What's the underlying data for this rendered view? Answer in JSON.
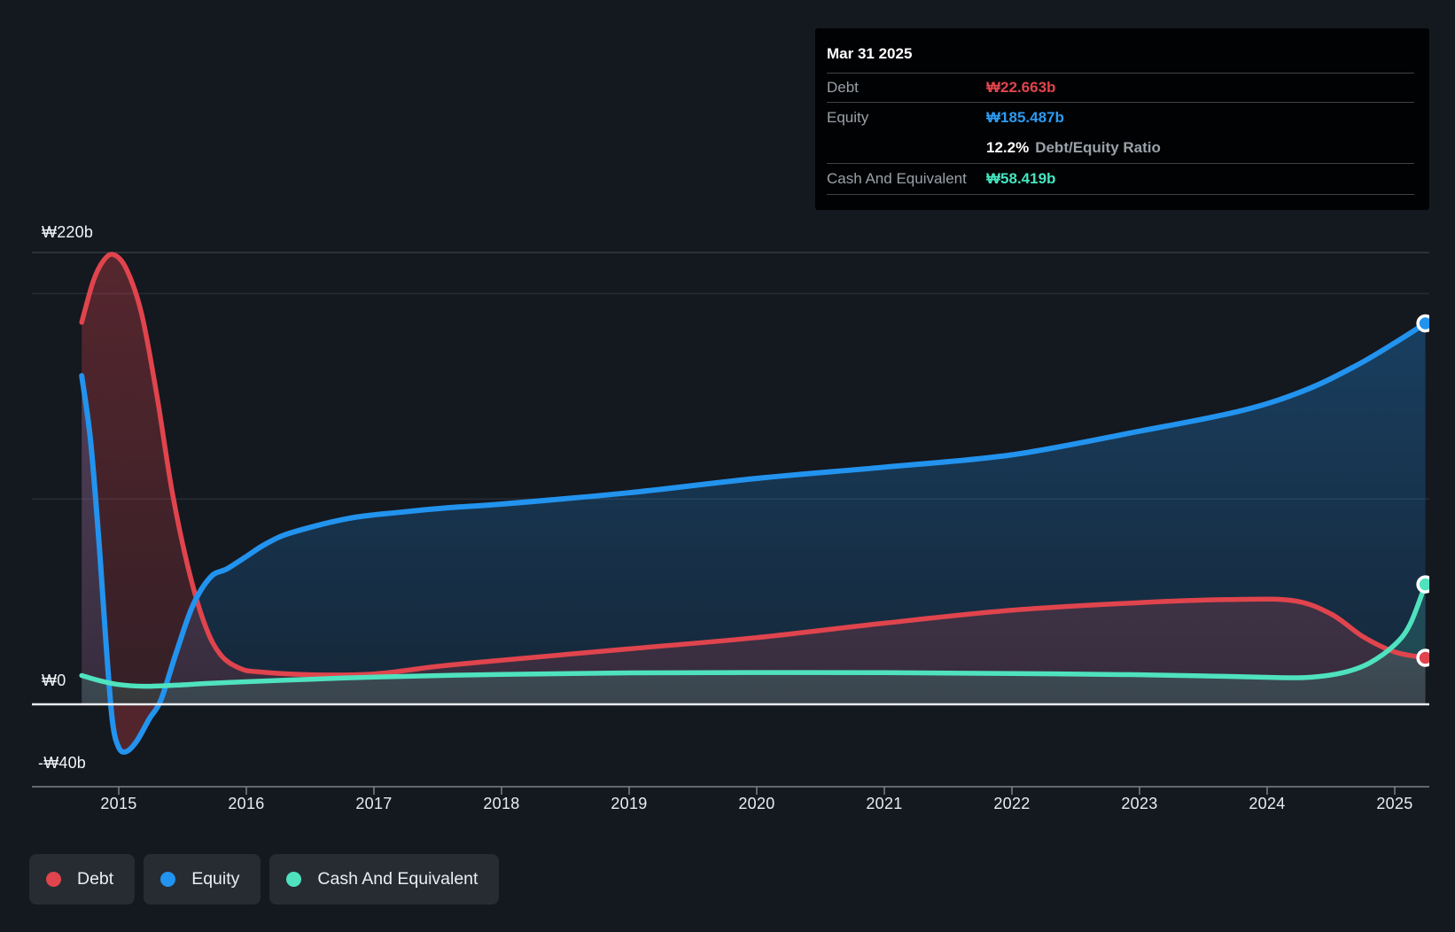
{
  "page": {
    "background": "#14181f"
  },
  "tooltip": {
    "title": "Mar 31 2025",
    "rows": [
      {
        "label": "Debt",
        "value": "₩22.663b"
      },
      {
        "label": "Equity",
        "value": "₩185.487b"
      },
      {
        "label": "Cash And Equivalent",
        "value": "₩58.419b"
      }
    ],
    "ratio_value": "12.2%",
    "ratio_label": "Debt/Equity Ratio"
  },
  "legend": {
    "items": [
      {
        "id": "debt",
        "label": "Debt",
        "color": "#e0444d"
      },
      {
        "id": "equity",
        "label": "Equity",
        "color": "#2293ee"
      },
      {
        "id": "cash",
        "label": "Cash And Equivalent",
        "color": "#4fe2bf"
      }
    ]
  },
  "chart_data": {
    "type": "area",
    "x_axis": {
      "ticks": [
        "2015",
        "2016",
        "2017",
        "2018",
        "2019",
        "2020",
        "2021",
        "2022",
        "2023",
        "2024",
        "2025"
      ],
      "range": [
        2014.71,
        2025.28
      ]
    },
    "y_axis": {
      "unit": "₩ billions",
      "labeled_ticks": [
        {
          "label": "₩220b",
          "value": 220
        },
        {
          "label": "₩0",
          "value": 0
        },
        {
          "label": "-₩40b",
          "value": -40
        }
      ],
      "gridline_values": [
        220,
        200,
        100
      ],
      "range": [
        -40,
        220
      ]
    },
    "series": [
      {
        "name": "Debt",
        "color": "#e0444d",
        "points": [
          [
            2014.71,
            186
          ],
          [
            2014.8,
            206
          ],
          [
            2014.88,
            216
          ],
          [
            2014.96,
            219
          ],
          [
            2015.06,
            212
          ],
          [
            2015.18,
            190
          ],
          [
            2015.3,
            150
          ],
          [
            2015.42,
            103
          ],
          [
            2015.55,
            65
          ],
          [
            2015.68,
            38
          ],
          [
            2015.8,
            24
          ],
          [
            2015.95,
            17.5
          ],
          [
            2016.1,
            15.8
          ],
          [
            2016.5,
            14.4
          ],
          [
            2017.0,
            14.8
          ],
          [
            2017.5,
            18.5
          ],
          [
            2018.0,
            21.5
          ],
          [
            2019.0,
            27
          ],
          [
            2020.0,
            32.5
          ],
          [
            2021.0,
            39.5
          ],
          [
            2022.0,
            45.8
          ],
          [
            2023.0,
            49.5
          ],
          [
            2023.7,
            51
          ],
          [
            2024.2,
            50.5
          ],
          [
            2024.5,
            44
          ],
          [
            2024.75,
            33
          ],
          [
            2025.0,
            25.5
          ],
          [
            2025.24,
            22.663
          ]
        ]
      },
      {
        "name": "Equity",
        "color": "#2293ee",
        "negative_fill": "#e0444d",
        "points": [
          [
            2014.71,
            160
          ],
          [
            2014.78,
            128
          ],
          [
            2014.85,
            75
          ],
          [
            2014.9,
            30
          ],
          [
            2014.95,
            -8
          ],
          [
            2015.0,
            -21
          ],
          [
            2015.06,
            -23
          ],
          [
            2015.14,
            -18
          ],
          [
            2015.24,
            -7
          ],
          [
            2015.33,
            2
          ],
          [
            2015.45,
            25
          ],
          [
            2015.58,
            48
          ],
          [
            2015.72,
            62
          ],
          [
            2015.85,
            66
          ],
          [
            2016.0,
            72
          ],
          [
            2016.15,
            78
          ],
          [
            2016.35,
            83.5
          ],
          [
            2016.8,
            90.5
          ],
          [
            2017.2,
            93.5
          ],
          [
            2017.6,
            95.8
          ],
          [
            2018.0,
            97.5
          ],
          [
            2019.0,
            103
          ],
          [
            2020.0,
            110
          ],
          [
            2021.0,
            115.5
          ],
          [
            2022.0,
            121.5
          ],
          [
            2023.0,
            133
          ],
          [
            2023.8,
            143
          ],
          [
            2024.3,
            153
          ],
          [
            2024.7,
            165
          ],
          [
            2025.0,
            176
          ],
          [
            2025.24,
            185.487
          ]
        ]
      },
      {
        "name": "Cash And Equivalent",
        "color": "#4fe2bf",
        "points": [
          [
            2014.71,
            14
          ],
          [
            2014.85,
            11.5
          ],
          [
            2015.0,
            9.6
          ],
          [
            2015.2,
            8.8
          ],
          [
            2015.45,
            9.3
          ],
          [
            2015.7,
            10.2
          ],
          [
            2016.0,
            11
          ],
          [
            2016.5,
            12.2
          ],
          [
            2017.0,
            13.3
          ],
          [
            2018.0,
            14.6
          ],
          [
            2019.0,
            15.3
          ],
          [
            2020.0,
            15.5
          ],
          [
            2021.0,
            15.4
          ],
          [
            2022.0,
            15
          ],
          [
            2023.0,
            14.4
          ],
          [
            2023.6,
            13.7
          ],
          [
            2024.1,
            13
          ],
          [
            2024.35,
            13.2
          ],
          [
            2024.6,
            15.5
          ],
          [
            2024.8,
            20
          ],
          [
            2025.0,
            29
          ],
          [
            2025.12,
            39
          ],
          [
            2025.24,
            58.419
          ]
        ]
      }
    ],
    "last_point": {
      "date": "Mar 31 2025",
      "debt": 22.663,
      "equity": 185.487,
      "cash": 58.419,
      "debt_equity_ratio": "12.2%"
    }
  }
}
